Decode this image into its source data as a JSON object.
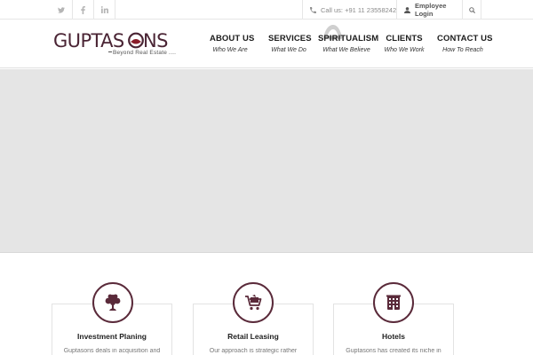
{
  "topbar": {
    "social": [
      "twitter-icon",
      "facebook-icon",
      "linkedin-icon"
    ],
    "call_label": "Call us: +91 11 23558242",
    "login_label": "Employee Login"
  },
  "logo": {
    "name": "GUPTASONS",
    "tagline": "Beyond Real Estate ...."
  },
  "nav": [
    {
      "label": "ABOUT US",
      "sub": "Who We Are"
    },
    {
      "label": "SERVICES",
      "sub": "What We Do"
    },
    {
      "label": "SPIRITUALISM",
      "sub": "What We Believe"
    },
    {
      "label": "CLIENTS",
      "sub": "Who We Work"
    },
    {
      "label": "CONTACT US",
      "sub": "How To Reach"
    }
  ],
  "cards": [
    {
      "title": "Investment Planing",
      "text": "Guptasons deals in acquisition and",
      "icon": "tree-icon"
    },
    {
      "title": "Retail Leasing",
      "text": "Our approach is strategic rather",
      "icon": "shopping-cart-icon"
    },
    {
      "title": "Hotels",
      "text": "Guptasons has created its niche in",
      "icon": "building-icon"
    }
  ],
  "colors": {
    "brand": "#5a2a3a",
    "slider_bg": "#e5e5e5"
  }
}
